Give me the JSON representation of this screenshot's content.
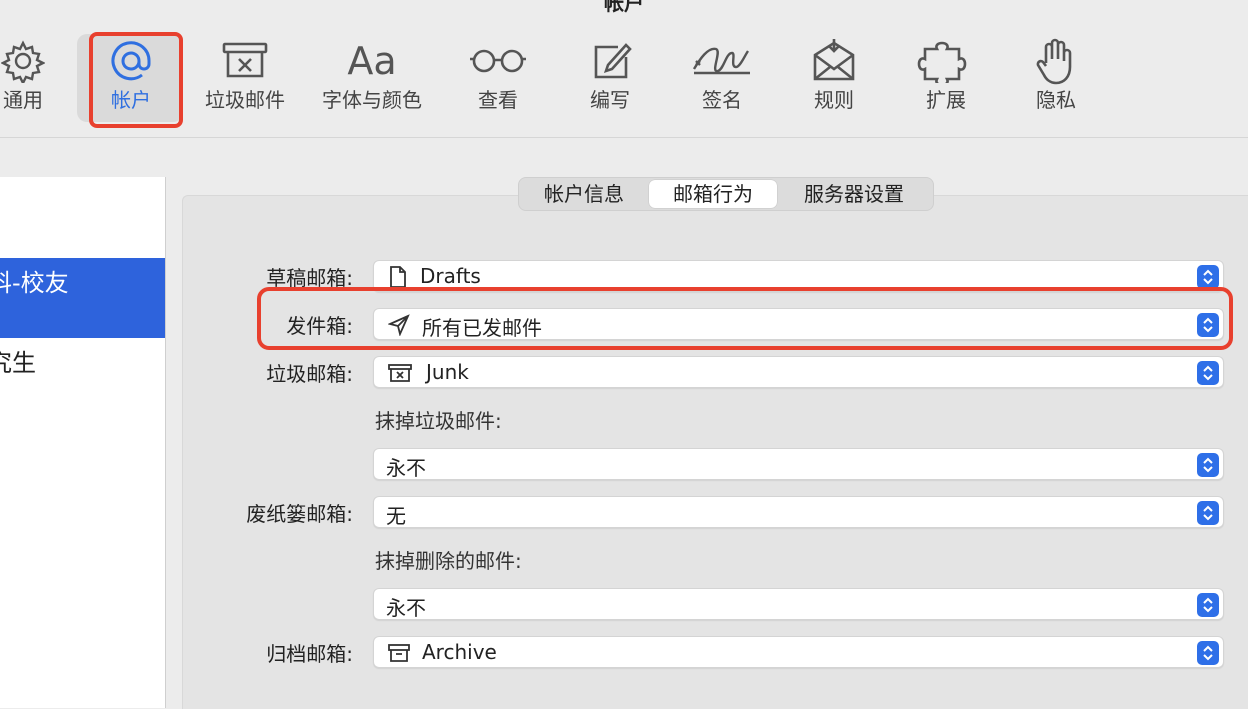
{
  "window": {
    "title": "帐户"
  },
  "toolbar": {
    "items": [
      {
        "label": "通用",
        "icon": "gear-icon"
      },
      {
        "label": "帐户",
        "icon": "at-sign-icon"
      },
      {
        "label": "垃圾邮件",
        "icon": "junk-tray-icon"
      },
      {
        "label": "字体与颜色",
        "icon": "font-aa-icon",
        "glyph": "Aa"
      },
      {
        "label": "查看",
        "icon": "glasses-icon"
      },
      {
        "label": "编写",
        "icon": "compose-icon"
      },
      {
        "label": "签名",
        "icon": "signature-icon"
      },
      {
        "label": "规则",
        "icon": "rules-envelope-icon"
      },
      {
        "label": "扩展",
        "icon": "puzzle-icon"
      },
      {
        "label": "隐私",
        "icon": "hand-icon"
      }
    ],
    "active_index": 1,
    "accent_color": "#2f6fe0",
    "highlight_color": "#e8402e"
  },
  "sidebar": {
    "items": [
      {
        "label": "科-校友",
        "selected": true
      },
      {
        "label": "究生",
        "selected": false
      }
    ],
    "selection_color": "#2e63dc"
  },
  "tabs": {
    "items": [
      "帐户信息",
      "邮箱行为",
      "服务器设置"
    ],
    "active_index": 1
  },
  "form": {
    "drafts": {
      "label": "草稿邮箱:",
      "value": "Drafts",
      "icon": "document-icon"
    },
    "sent": {
      "label": "发件箱:",
      "value": "所有已发邮件",
      "icon": "paper-plane-icon"
    },
    "junk": {
      "label": "垃圾邮箱:",
      "value": "Junk",
      "icon": "junk-tray-icon"
    },
    "erase_junk": {
      "label": "抹掉垃圾邮件:",
      "value": "永不"
    },
    "trash": {
      "label": "废纸篓邮箱:",
      "value": "无"
    },
    "erase_deleted": {
      "label": "抹掉删除的邮件:",
      "value": "永不"
    },
    "archive": {
      "label": "归档邮箱:",
      "value": "Archive",
      "icon": "archive-box-icon"
    }
  }
}
